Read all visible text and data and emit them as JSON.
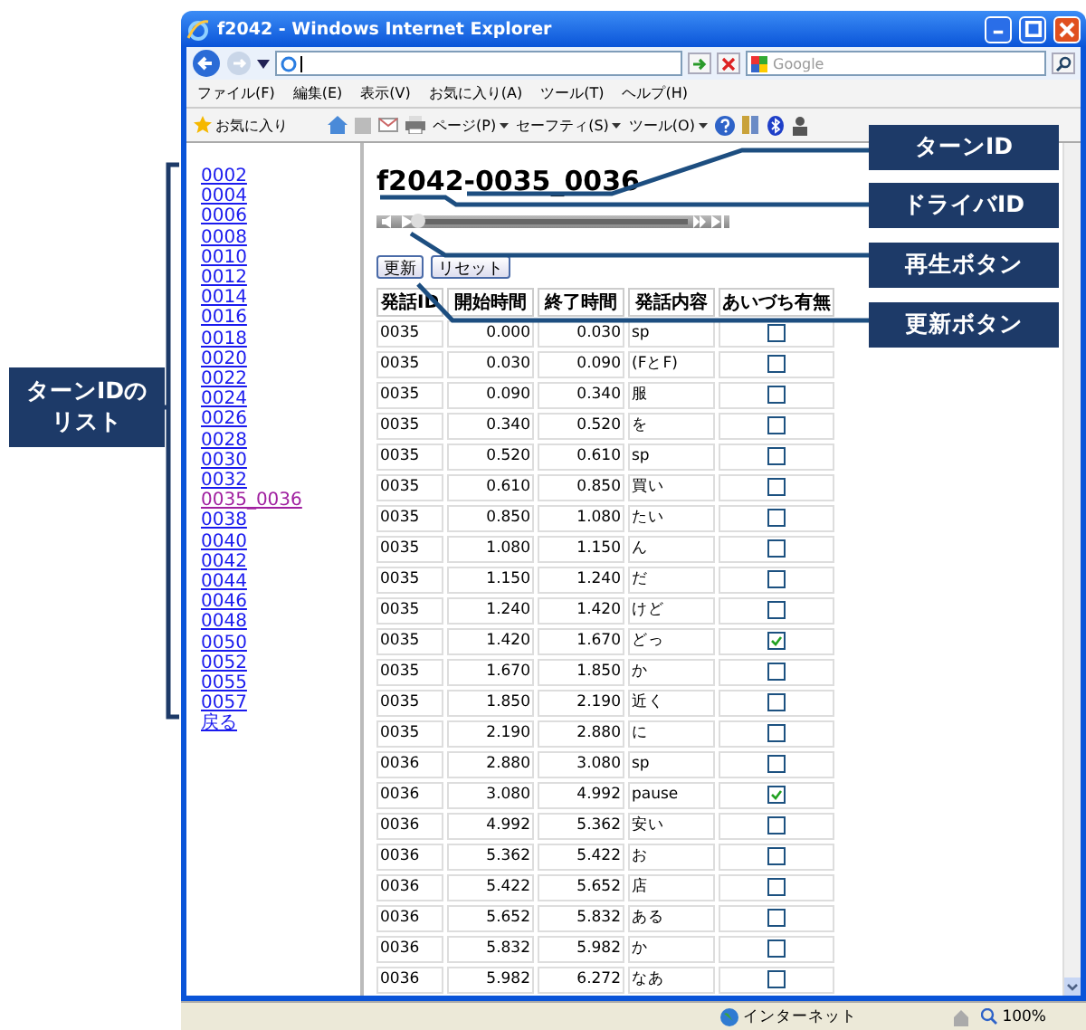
{
  "window": {
    "title": "f2042 - Windows Internet Explorer"
  },
  "search": {
    "placeholder": "Google"
  },
  "menu": [
    "ファイル(F)",
    "編集(E)",
    "表示(V)",
    "お気に入り(A)",
    "ツール(T)",
    "ヘルプ(H)"
  ],
  "command_bar": {
    "favorites": "お気に入り",
    "items": [
      "ページ(P)",
      "セーフティ(S)",
      "ツール(O)"
    ]
  },
  "turn_list": [
    {
      "label": "0002",
      "visited": false
    },
    {
      "label": "0004",
      "visited": false
    },
    {
      "label": "0006",
      "visited": false
    },
    {
      "label": "0008",
      "visited": false
    },
    {
      "label": "0010",
      "visited": false
    },
    {
      "label": "0012",
      "visited": false
    },
    {
      "label": "0014",
      "visited": false
    },
    {
      "label": "0016",
      "visited": false
    },
    {
      "label": "0018",
      "visited": false
    },
    {
      "label": "0020",
      "visited": false
    },
    {
      "label": "0022",
      "visited": false
    },
    {
      "label": "0024",
      "visited": false
    },
    {
      "label": "0026",
      "visited": false
    },
    {
      "label": "0028",
      "visited": false
    },
    {
      "label": "0030",
      "visited": false
    },
    {
      "label": "0032",
      "visited": false
    },
    {
      "label": "0035_0036",
      "visited": true
    },
    {
      "label": "0038",
      "visited": false
    },
    {
      "label": "0040",
      "visited": false
    },
    {
      "label": "0042",
      "visited": false
    },
    {
      "label": "0044",
      "visited": false
    },
    {
      "label": "0046",
      "visited": false
    },
    {
      "label": "0048",
      "visited": false
    },
    {
      "label": "0050",
      "visited": false
    },
    {
      "label": "0052",
      "visited": false
    },
    {
      "label": "0055",
      "visited": false
    },
    {
      "label": "0057",
      "visited": false
    },
    {
      "label": "戻る",
      "visited": false
    }
  ],
  "page": {
    "heading": "f2042-0035_0036",
    "player": {
      "level": 0
    },
    "buttons": [
      "更新",
      "リセット"
    ],
    "table": {
      "columns": [
        "発話ID",
        "開始時間",
        "終了時間",
        "発話内容",
        "あいづち有無"
      ],
      "rows": [
        {
          "cells": [
            "0035",
            "0.000",
            "0.030",
            "sp"
          ],
          "checked": false
        },
        {
          "cells": [
            "0035",
            "0.030",
            "0.090",
            "(FとF)"
          ],
          "checked": false
        },
        {
          "cells": [
            "0035",
            "0.090",
            "0.340",
            "服"
          ],
          "checked": false
        },
        {
          "cells": [
            "0035",
            "0.340",
            "0.520",
            "を"
          ],
          "checked": false
        },
        {
          "cells": [
            "0035",
            "0.520",
            "0.610",
            "sp"
          ],
          "checked": false
        },
        {
          "cells": [
            "0035",
            "0.610",
            "0.850",
            "買い"
          ],
          "checked": false
        },
        {
          "cells": [
            "0035",
            "0.850",
            "1.080",
            "たい"
          ],
          "checked": false
        },
        {
          "cells": [
            "0035",
            "1.080",
            "1.150",
            "ん"
          ],
          "checked": false
        },
        {
          "cells": [
            "0035",
            "1.150",
            "1.240",
            "だ"
          ],
          "checked": false
        },
        {
          "cells": [
            "0035",
            "1.240",
            "1.420",
            "けど"
          ],
          "checked": false
        },
        {
          "cells": [
            "0035",
            "1.420",
            "1.670",
            "どっ"
          ],
          "checked": true
        },
        {
          "cells": [
            "0035",
            "1.670",
            "1.850",
            "か"
          ],
          "checked": false
        },
        {
          "cells": [
            "0035",
            "1.850",
            "2.190",
            "近く"
          ],
          "checked": false
        },
        {
          "cells": [
            "0035",
            "2.190",
            "2.880",
            "に"
          ],
          "checked": false
        },
        {
          "cells": [
            "0036",
            "2.880",
            "3.080",
            "sp"
          ],
          "checked": false
        },
        {
          "cells": [
            "0036",
            "3.080",
            "4.992",
            "pause"
          ],
          "checked": true
        },
        {
          "cells": [
            "0036",
            "4.992",
            "5.362",
            "安い"
          ],
          "checked": false
        },
        {
          "cells": [
            "0036",
            "5.362",
            "5.422",
            "お"
          ],
          "checked": false
        },
        {
          "cells": [
            "0036",
            "5.422",
            "5.652",
            "店"
          ],
          "checked": false
        },
        {
          "cells": [
            "0036",
            "5.652",
            "5.832",
            "ある"
          ],
          "checked": false
        },
        {
          "cells": [
            "0036",
            "5.832",
            "5.982",
            "か"
          ],
          "checked": false
        },
        {
          "cells": [
            "0036",
            "5.982",
            "6.272",
            "なあ"
          ],
          "checked": false
        }
      ]
    }
  },
  "status_bar": {
    "zone": "インターネット",
    "zoom": "100%"
  },
  "annotations": {
    "list_label": "ターンIDのリスト",
    "callouts": [
      "ターンID",
      "ドライバID",
      "再生ボタン",
      "更新ボタン"
    ]
  }
}
